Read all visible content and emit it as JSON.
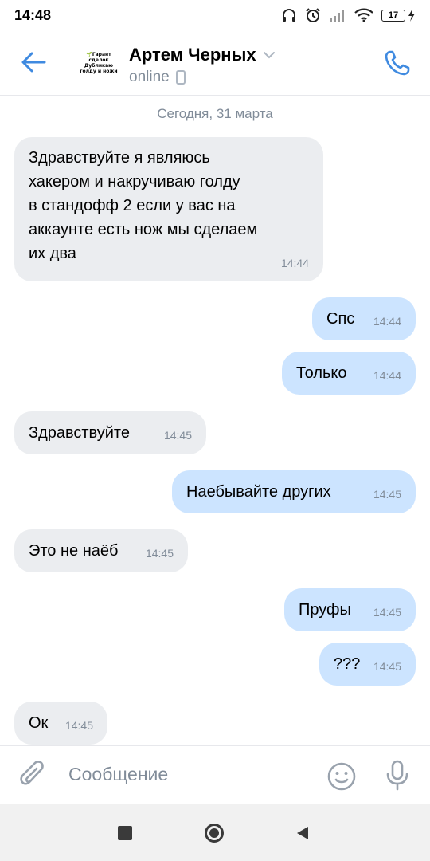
{
  "status_bar": {
    "time": "14:48",
    "battery": "17"
  },
  "header": {
    "avatar_lines": [
      "🌱Гарант",
      "сделок",
      "Дубликаю",
      "голду и ножи"
    ],
    "contact_name": "Артем Черных",
    "contact_status": "online"
  },
  "chat": {
    "date_separator": "Сегодня, 31 марта",
    "messages": [
      {
        "direction": "in",
        "lines": [
          "Здравствуйте я являюсь",
          "хакером и накручиваю голду",
          "в стандофф 2 если у вас на",
          "аккаунте есть нож мы сделаем",
          "их два"
        ],
        "time": "14:44"
      },
      {
        "direction": "out",
        "lines": [
          "Спс"
        ],
        "time": "14:44"
      },
      {
        "direction": "out",
        "lines": [
          "Только"
        ],
        "time": "14:44"
      },
      {
        "direction": "in",
        "lines": [
          "Здравствуйте"
        ],
        "time": "14:45"
      },
      {
        "direction": "out",
        "lines": [
          "Наебывайте других"
        ],
        "time": "14:45"
      },
      {
        "direction": "in",
        "lines": [
          "Это не наёб"
        ],
        "time": "14:45"
      },
      {
        "direction": "out",
        "lines": [
          "Пруфы"
        ],
        "time": "14:45"
      },
      {
        "direction": "out",
        "lines": [
          "???"
        ],
        "time": "14:45"
      },
      {
        "direction": "in",
        "lines": [
          "Ок"
        ],
        "time": "14:45"
      }
    ]
  },
  "composer": {
    "placeholder": "Сообщение"
  },
  "icons": {
    "back": "arrow-left-icon",
    "phone": "phone-icon",
    "attach": "paperclip-icon",
    "emoji": "smile-icon",
    "mic": "microphone-icon"
  },
  "colors": {
    "accent": "#3f8ae0",
    "incoming_bubble": "#ebedf0",
    "outgoing_bubble": "#cce4ff",
    "secondary_text": "#818c99"
  }
}
